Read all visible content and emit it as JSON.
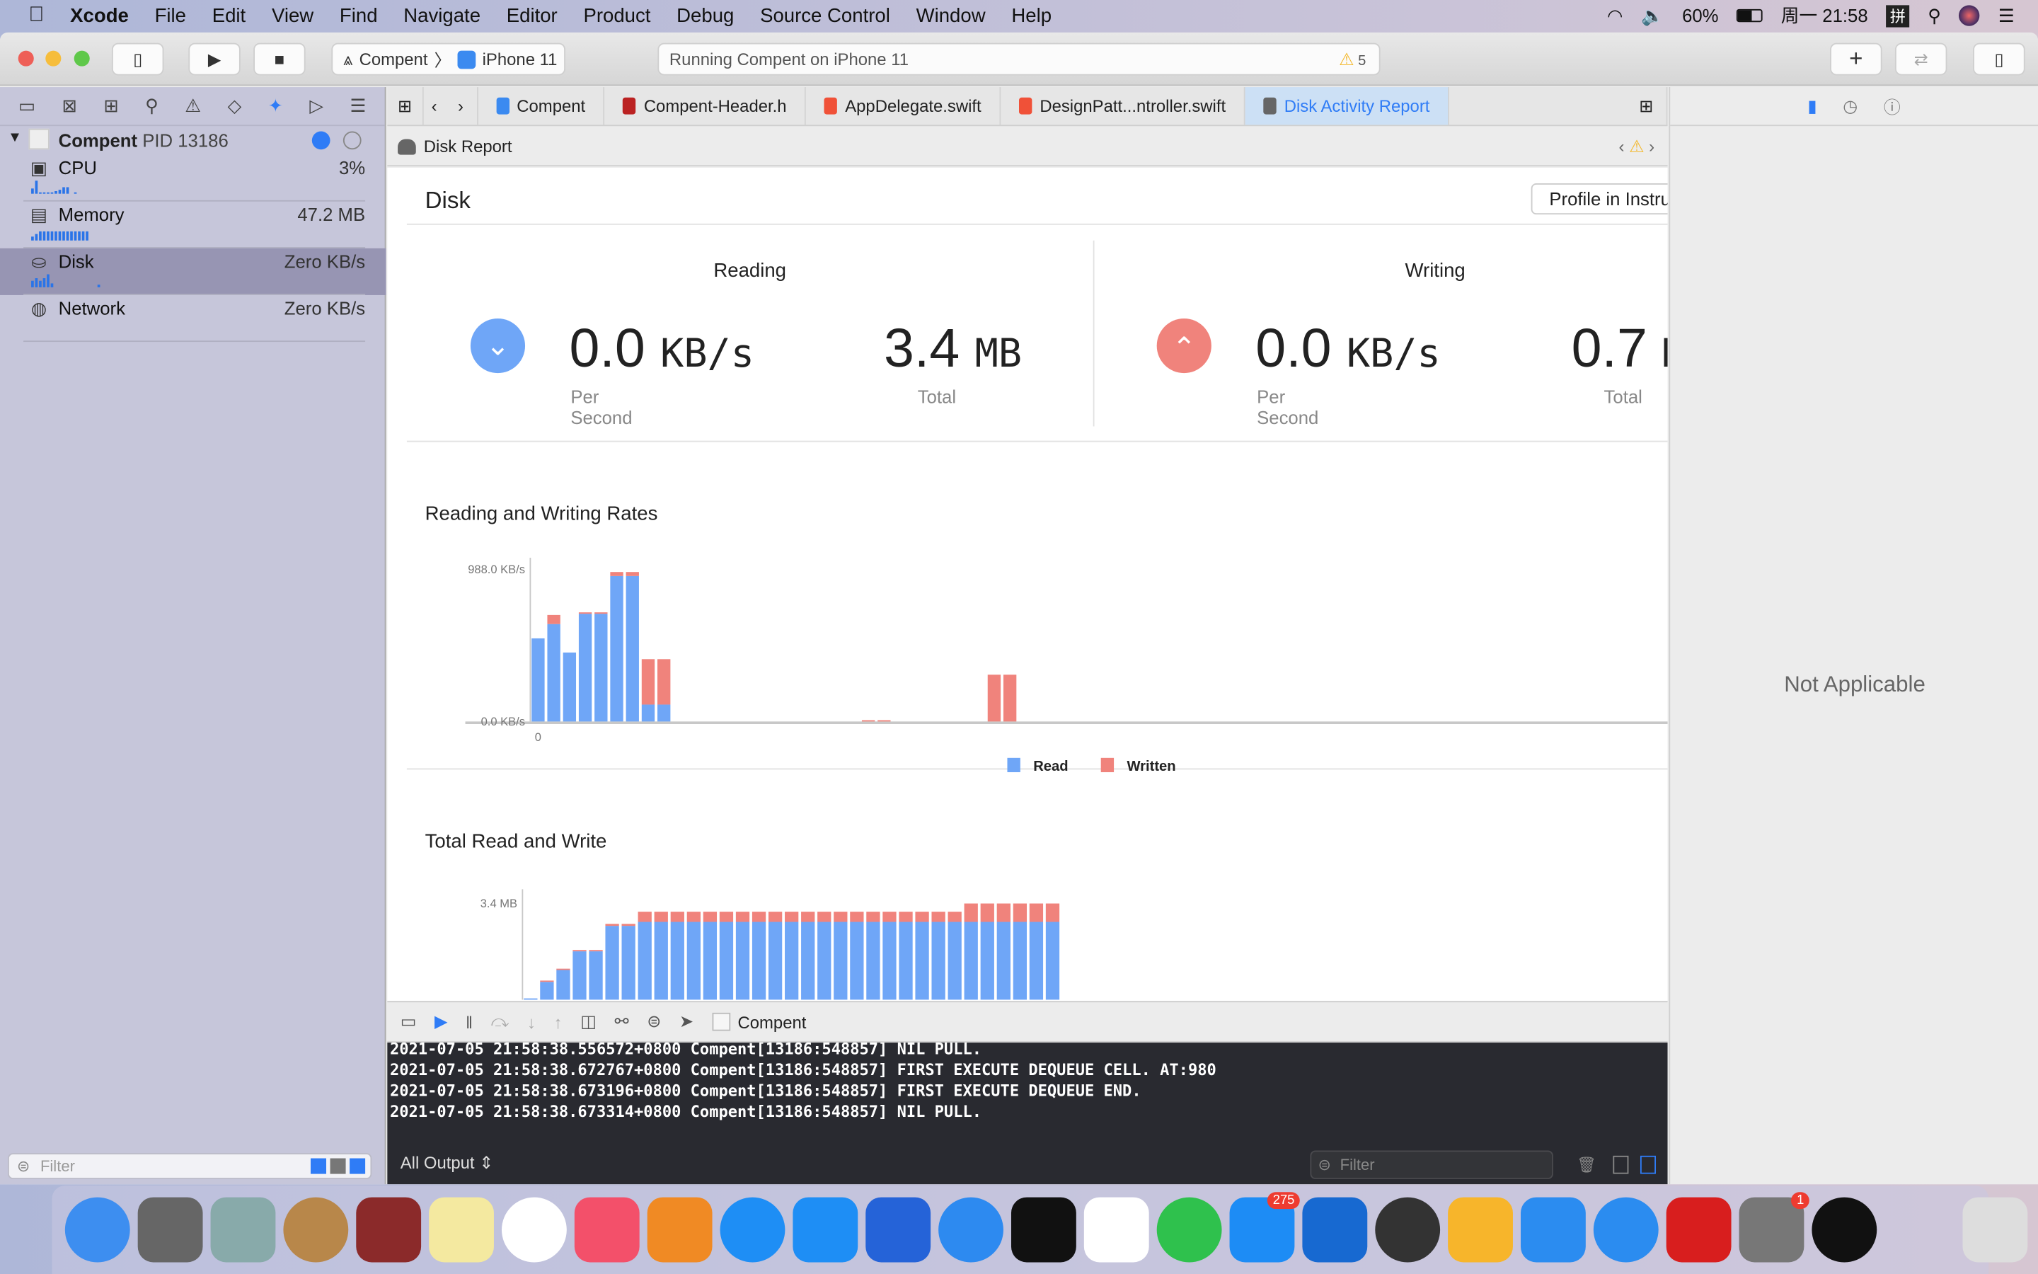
{
  "menubar": {
    "app": "Xcode",
    "items": [
      "File",
      "Edit",
      "View",
      "Find",
      "Navigate",
      "Editor",
      "Product",
      "Debug",
      "Source Control",
      "Window",
      "Help"
    ],
    "battery": "60%",
    "clock": "周一 21:58",
    "input_method": "拼"
  },
  "toolbar": {
    "scheme": "Compent",
    "device": "iPhone 11",
    "status": "Running Compent on iPhone 11",
    "warnings": "5"
  },
  "navigator": {
    "process": "Compent",
    "pid": "PID 13186",
    "gauges": [
      {
        "label": "CPU",
        "value": "3%",
        "spark": [
          4,
          10,
          1,
          1,
          1,
          1,
          2,
          3,
          5,
          5,
          0,
          1
        ]
      },
      {
        "label": "Memory",
        "value": "47.2 MB",
        "spark": [
          3,
          5,
          7,
          7,
          7,
          7,
          7,
          7,
          7,
          7,
          7,
          7,
          7,
          7,
          7
        ]
      },
      {
        "label": "Disk",
        "value": "Zero KB/s",
        "spark": [
          5,
          7,
          5,
          7,
          10,
          3,
          0,
          0,
          0,
          0,
          0,
          0,
          0,
          0,
          0,
          0,
          0,
          2
        ]
      },
      {
        "label": "Network",
        "value": "Zero KB/s",
        "spark": []
      }
    ],
    "filter_placeholder": "Filter"
  },
  "tabs": [
    {
      "label": "Compent"
    },
    {
      "label": "Compent-Header.h"
    },
    {
      "label": "AppDelegate.swift"
    },
    {
      "label": "DesignPatt...ntroller.swift"
    },
    {
      "label": "Disk Activity Report",
      "active": true
    }
  ],
  "jumpbar": {
    "title": "Disk Report"
  },
  "report": {
    "title": "Disk",
    "profile_button": "Profile in Instruments",
    "reading": {
      "heading": "Reading",
      "rate": "0.0",
      "rate_unit": "KB/s",
      "rate_label": "Per Second",
      "total": "3.4",
      "total_unit": "MB",
      "total_label": "Total"
    },
    "writing": {
      "heading": "Writing",
      "rate": "0.0",
      "rate_unit": "KB/s",
      "rate_label": "Per Second",
      "total": "0.7",
      "total_unit": "MB",
      "total_label": "Total"
    }
  },
  "inspector": {
    "empty": "Not Applicable"
  },
  "debugbar": {
    "process": "Compent"
  },
  "console": {
    "lines": [
      "2021-07-05 21:58:38.556572+0800 Compent[13186:548857] NIL PULL.",
      "2021-07-05 21:58:38.672767+0800 Compent[13186:548857] FIRST EXECUTE DEQUEUE CELL. AT:980",
      "2021-07-05 21:58:38.673196+0800 Compent[13186:548857] FIRST EXECUTE DEQUEUE END.",
      "2021-07-05 21:58:38.673314+0800 Compent[13186:548857] NIL PULL."
    ],
    "output_selector": "All Output",
    "filter_placeholder": "Filter"
  },
  "colors": {
    "read": "#6fa6f7",
    "written": "#f0837c",
    "accent": "#2f7cf6"
  },
  "dock": [
    "Finder",
    "Launchpad",
    "Mail",
    "Contacts",
    "Dictionary",
    "Notes",
    "Photos",
    "Music",
    "Books",
    "App Store",
    "Safari",
    "Remote Desktop",
    "Lark",
    "WeChat",
    "Chrome",
    "FaceTime",
    "Messages",
    "OneDrive",
    "Instruments",
    "Sketch",
    "Xcode",
    "Simulator",
    "NetEase Music",
    "System Preferences",
    "Terminal",
    "Trash"
  ],
  "dock_badges": {
    "Messages": "275",
    "System Preferences": "1"
  },
  "chart_data": [
    {
      "type": "bar",
      "stacked": true,
      "title": "Reading and Writing Rates",
      "ylabel": "",
      "ylim": [
        0,
        988
      ],
      "y_ticks": [
        "0.0 KB/s",
        "988.0 KB/s"
      ],
      "x_ticks": [
        "0"
      ],
      "legend": [
        "Read",
        "Written"
      ],
      "legend_position": "bottom",
      "series": [
        {
          "name": "Read",
          "values": [
            540,
            633,
            448,
            700,
            700,
            945,
            945,
            110,
            110,
            0,
            0,
            0,
            0,
            0,
            0,
            0,
            0,
            0,
            0,
            0,
            0,
            0,
            0,
            0,
            0,
            0,
            0,
            0,
            0,
            0,
            0,
            0,
            0,
            0,
            0,
            0,
            0,
            0,
            0,
            0,
            0,
            0,
            0,
            0,
            0,
            0,
            0,
            0,
            0,
            0,
            0,
            0,
            0,
            0,
            0,
            0,
            0,
            0,
            0,
            0,
            0,
            0,
            0,
            0,
            0,
            0,
            0,
            0,
            0,
            0,
            0,
            0,
            0,
            0,
            0,
            0,
            0,
            0,
            0,
            0
          ]
        },
        {
          "name": "Written",
          "values": [
            0,
            59,
            0,
            9,
            9,
            26,
            26,
            295,
            295,
            0,
            0,
            0,
            0,
            0,
            0,
            0,
            0,
            0,
            0,
            0,
            0,
            2,
            2,
            0,
            0,
            0,
            0,
            0,
            0,
            304,
            304,
            0,
            0,
            0,
            0,
            0,
            0,
            0,
            0,
            0,
            0,
            0,
            0,
            0,
            0,
            0,
            0,
            0,
            0,
            0,
            0,
            0,
            0,
            0,
            0,
            0,
            0,
            0,
            0,
            0,
            0,
            0,
            0,
            0,
            0,
            0,
            0,
            0,
            0,
            0,
            0,
            0,
            0,
            0,
            0,
            0,
            0,
            0,
            0,
            0
          ]
        }
      ]
    },
    {
      "type": "bar",
      "stacked": true,
      "title": "Total Read and Write",
      "ylabel": "",
      "ylim": [
        0,
        3.4
      ],
      "y_ticks": [
        "3.4 MB"
      ],
      "series": [
        {
          "name": "Read",
          "values": [
            0.03,
            0.63,
            1.05,
            1.71,
            1.71,
            2.61,
            2.61,
            2.75,
            2.75,
            2.75,
            2.75,
            2.75,
            2.75,
            2.75,
            2.75,
            2.75,
            2.75,
            2.75,
            2.75,
            2.75,
            2.75,
            2.75,
            2.75,
            2.75,
            2.75,
            2.75,
            2.75,
            2.75,
            2.75,
            2.75,
            2.75,
            2.75,
            2.75
          ]
        },
        {
          "name": "Written",
          "values": [
            0,
            0.03,
            0.03,
            0.03,
            0.03,
            0.07,
            0.07,
            0.36,
            0.36,
            0.36,
            0.36,
            0.36,
            0.36,
            0.36,
            0.36,
            0.36,
            0.36,
            0.36,
            0.36,
            0.36,
            0.36,
            0.36,
            0.36,
            0.36,
            0.36,
            0.36,
            0.36,
            0.65,
            0.65,
            0.65,
            0.65,
            0.65,
            0.65
          ]
        }
      ]
    }
  ]
}
